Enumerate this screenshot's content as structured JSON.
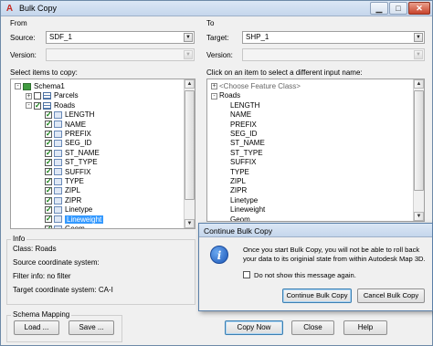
{
  "window": {
    "title": "Bulk Copy",
    "app_icon": "autocad-a-icon",
    "controls": [
      "minimize",
      "maximize",
      "close"
    ]
  },
  "from": {
    "heading": "From",
    "source_label": "Source:",
    "source_value": "SDF_1",
    "version_label": "Version:",
    "version_value": "",
    "items_label": "Select items to copy:",
    "tree": [
      {
        "label": "Schema1",
        "level": 0,
        "expander": "-",
        "icon": "schema-icon"
      },
      {
        "label": "Parcels",
        "level": 1,
        "expander": "+",
        "checked": false,
        "icon": "table-icon"
      },
      {
        "label": "Roads",
        "level": 1,
        "expander": "-",
        "checked": true,
        "icon": "table-icon"
      },
      {
        "label": "LENGTH",
        "level": 2,
        "checked": true
      },
      {
        "label": "NAME",
        "level": 2,
        "checked": true
      },
      {
        "label": "PREFIX",
        "level": 2,
        "checked": true
      },
      {
        "label": "SEG_ID",
        "level": 2,
        "checked": true
      },
      {
        "label": "ST_NAME",
        "level": 2,
        "checked": true
      },
      {
        "label": "ST_TYPE",
        "level": 2,
        "checked": true
      },
      {
        "label": "SUFFIX",
        "level": 2,
        "checked": true
      },
      {
        "label": "TYPE",
        "level": 2,
        "checked": true
      },
      {
        "label": "ZIPL",
        "level": 2,
        "checked": true
      },
      {
        "label": "ZIPR",
        "level": 2,
        "checked": true
      },
      {
        "label": "Linetype",
        "level": 2,
        "checked": true
      },
      {
        "label": "Lineweight",
        "level": 2,
        "checked": true,
        "selected": true
      },
      {
        "label": "Geom",
        "level": 2,
        "checked": true
      }
    ]
  },
  "to": {
    "heading": "To",
    "target_label": "Target:",
    "target_value": "SHP_1",
    "version_label": "Version:",
    "version_value": "",
    "items_label": "Click on an item to select a different input name:",
    "tree": [
      {
        "label": "<Choose Feature Class>",
        "level": 0,
        "expander": "+",
        "muted": true
      },
      {
        "label": "Roads",
        "level": 0,
        "expander": "-"
      },
      {
        "label": "LENGTH",
        "level": 1
      },
      {
        "label": "NAME",
        "level": 1
      },
      {
        "label": "PREFIX",
        "level": 1
      },
      {
        "label": "SEG_ID",
        "level": 1
      },
      {
        "label": "ST_NAME",
        "level": 1
      },
      {
        "label": "ST_TYPE",
        "level": 1
      },
      {
        "label": "SUFFIX",
        "level": 1
      },
      {
        "label": "TYPE",
        "level": 1
      },
      {
        "label": "ZIPL",
        "level": 1
      },
      {
        "label": "ZIPR",
        "level": 1
      },
      {
        "label": "Linetype",
        "level": 1
      },
      {
        "label": "Lineweight",
        "level": 1
      },
      {
        "label": "Geom",
        "level": 1
      }
    ]
  },
  "info": {
    "heading": "Info",
    "class_line": "Class: Roads",
    "source_cs": "Source coordinate system:",
    "filter": "Filter info: no filter",
    "target_cs": "Target coordinate system: CA-I"
  },
  "schema_mapping": {
    "heading": "Schema Mapping",
    "load_label": "Load ...",
    "save_label": "Save ..."
  },
  "buttons": {
    "copy_now": "Copy Now",
    "close": "Close",
    "help": "Help"
  },
  "dialog": {
    "title": "Continue Bulk Copy",
    "icon": "info-icon",
    "message_line1": "Once you start Bulk Copy, you will not be able to roll back",
    "message_line2": "your data to its originial state from within Autodesk Map 3D.",
    "checkbox_label": "Do not show this message again.",
    "checkbox_checked": false,
    "continue_label": "Continue Bulk Copy",
    "cancel_label": "Cancel Bulk Copy"
  },
  "colors": {
    "selection": "#3399ff",
    "titlebar": "#c5d6ec",
    "check_green": "#0a7a0a"
  }
}
